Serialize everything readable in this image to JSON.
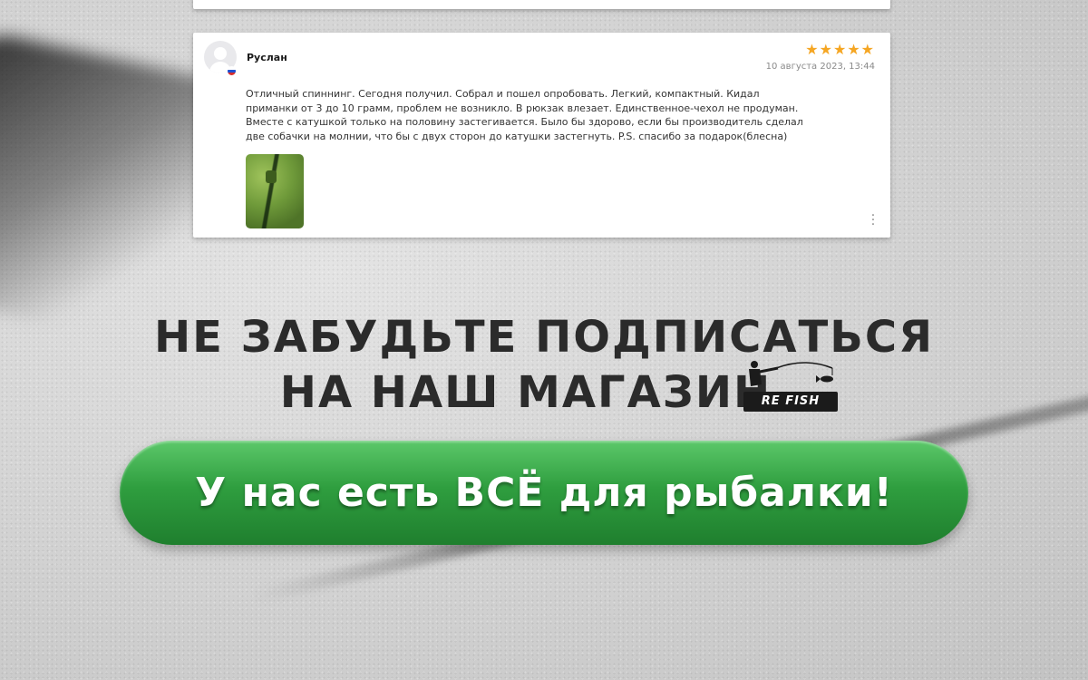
{
  "review": {
    "author": "Руслан",
    "rating": 5,
    "stars": "★★★★★",
    "date": "10 августа 2023, 13:44",
    "text": "Отличный спиннинг. Сегодня получил. Собрал и пошел опробовать. Легкий, компактный. Кидал приманки от 3 до 10 грамм, проблем не возникло. В рюкзак влезает. Единственное-чехол не продуман. Вместе с катушкой только на половину застегивается. Было бы здорово, если бы производитель сделал две собачки на молнии, что бы с двух сторон до катушки застегнуть. P.S. спасибо за подарок(блесна)",
    "more_icon": "more-vertical-icon",
    "star_color": "#f5a623"
  },
  "promo": {
    "line1": "НЕ ЗАБУДЬТЕ ПОДПИСАТЬСЯ",
    "line2": "НА НАШ МАГАЗИН",
    "logo_text": "RE FISH",
    "cta": "У нас есть ВСЁ для рыбалки!",
    "cta_color": "#2f9e3f"
  }
}
